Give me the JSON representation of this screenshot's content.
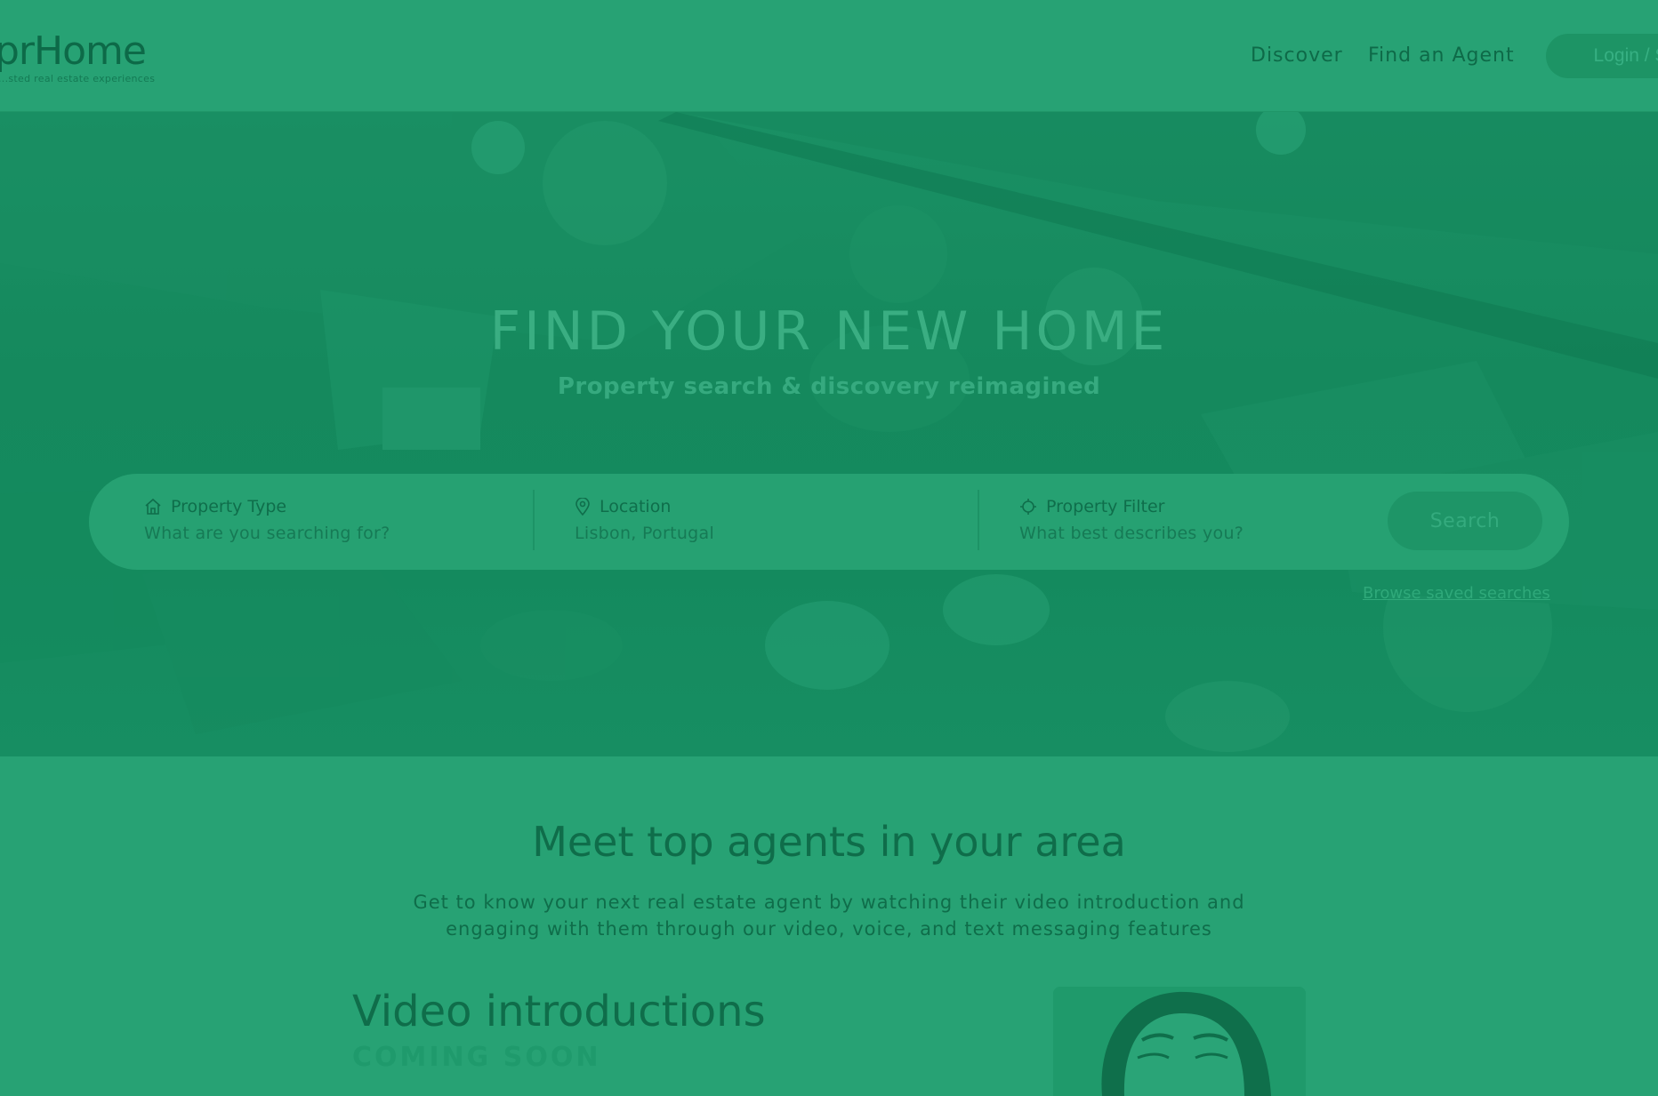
{
  "header": {
    "logo_text": "prHome",
    "logo_tagline": "...sted real estate experiences",
    "nav": [
      {
        "label": "Discover"
      },
      {
        "label": "Find an Agent"
      }
    ],
    "login_label": "Login / S"
  },
  "hero": {
    "title": "FIND YOUR NEW HOME",
    "subtitle": "Property search & discovery reimagined",
    "search": {
      "property_type": {
        "label": "Property Type",
        "value": "What are you searching for?",
        "icon": "home-icon"
      },
      "location": {
        "label": "Location",
        "value": "Lisbon, Portugal",
        "icon": "map-pin-icon"
      },
      "property_filter": {
        "label": "Property Filter",
        "value": "What best describes you?",
        "icon": "filter-icon"
      },
      "button_label": "Search"
    },
    "saved_link": "Browse saved searches"
  },
  "agents": {
    "title": "Meet top agents in your area",
    "description": "Get to know your next real estate agent by watching their video introduction and engaging with them through our video, voice, and text messaging features"
  },
  "video_intro": {
    "title": "Video introductions",
    "badge": "COMING SOON"
  },
  "colors": {
    "overlay_green": "#27a274",
    "dark_green_text": "#0f6d4a",
    "hero_green": "#15895d"
  }
}
